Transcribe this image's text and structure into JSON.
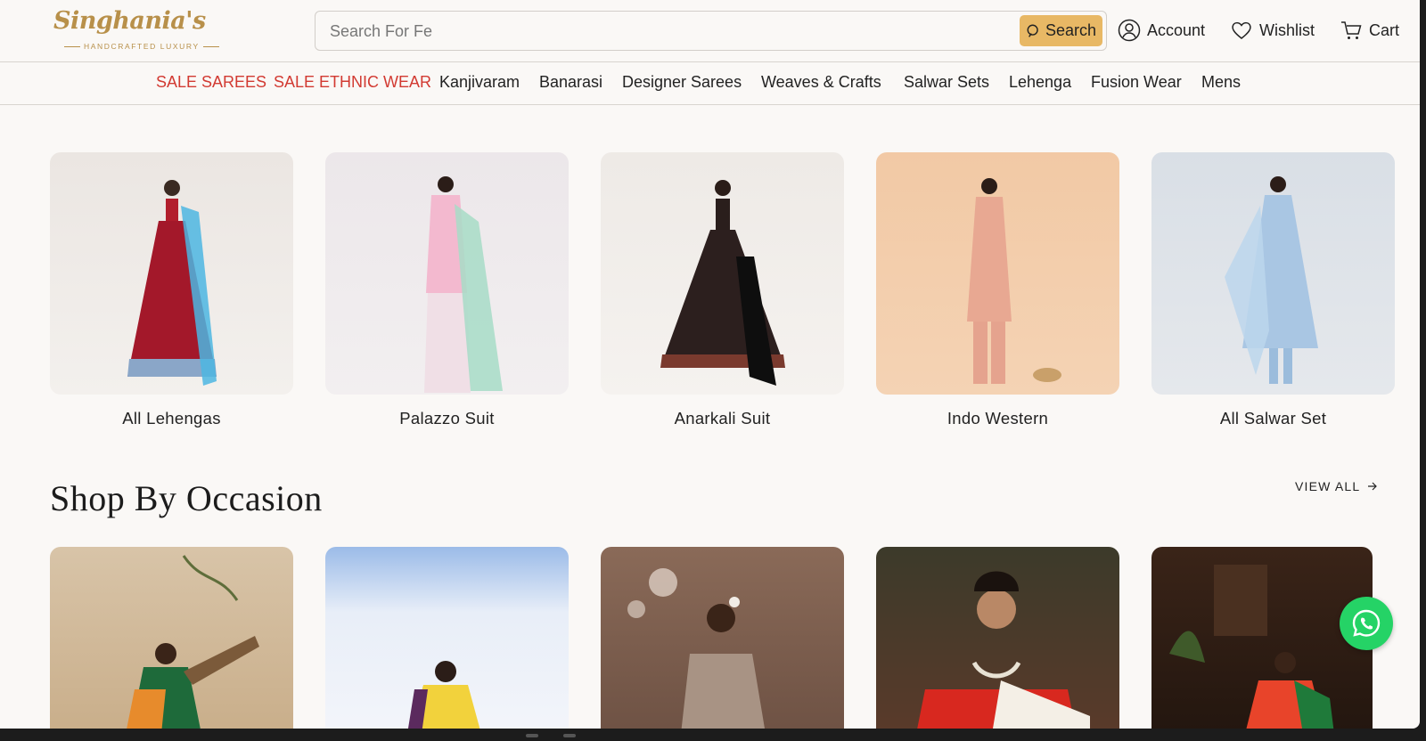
{
  "brand": {
    "name": "Singhania's",
    "tagline": "HANDCRAFTED LUXURY",
    "gold": "#b8904a"
  },
  "search": {
    "placeholder": "Search For Fe",
    "button_label": "Search",
    "button_color": "#e8b865"
  },
  "header_links": {
    "account": "Account",
    "wishlist": "Wishlist",
    "cart": "Cart"
  },
  "nav": {
    "sale_color": "#d23a32",
    "items": [
      "SALE SAREES",
      "SALE ETHNIC WEAR",
      "Kanjivaram",
      "Banarasi",
      "Designer Sarees",
      "Weaves & Crafts",
      "Salwar Sets",
      "Lehenga",
      "Fusion Wear",
      "Mens"
    ]
  },
  "categories": [
    {
      "label": "All Lehengas",
      "image": "woman-in-red-lehenga-with-blue-dupatta"
    },
    {
      "label": "Palazzo Suit",
      "image": "woman-in-pink-suit-with-mint-dupatta"
    },
    {
      "label": "Anarkali Suit",
      "image": "woman-in-black-printed-anarkali"
    },
    {
      "label": "Indo Western",
      "image": "woman-in-peach-kurta-set"
    },
    {
      "label": "All Salwar Set",
      "image": "woman-in-light-blue-salwar-set"
    }
  ],
  "occasion": {
    "title": "Shop By Occasion",
    "view_all": "VIEW ALL",
    "cards": [
      {
        "image": "woman-in-saree-playing-sitar"
      },
      {
        "image": "woman-in-yellow-saree-white-curtains"
      },
      {
        "image": "woman-in-embellished-saree-with-flowers"
      },
      {
        "image": "woman-in-red-white-saree-with-necklace"
      },
      {
        "image": "woman-in-orange-green-saree-dark-room"
      }
    ]
  },
  "whatsapp": {
    "icon": "whatsapp-icon",
    "color": "#25d366"
  }
}
